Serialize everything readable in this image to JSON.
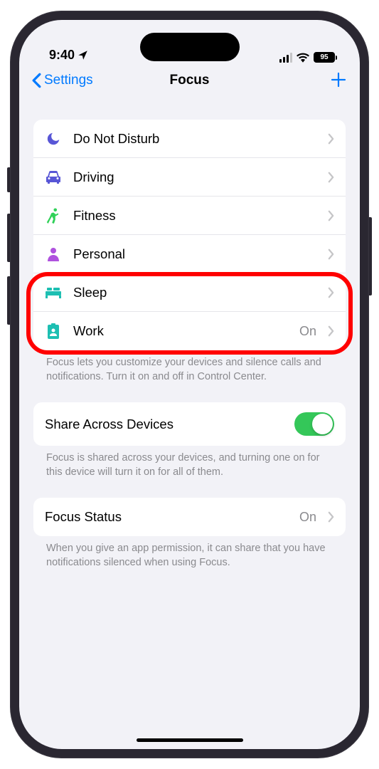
{
  "status": {
    "time": "9:40",
    "battery": "95"
  },
  "nav": {
    "back": "Settings",
    "title": "Focus"
  },
  "focus_modes": [
    {
      "label": "Do Not Disturb",
      "value": ""
    },
    {
      "label": "Driving",
      "value": ""
    },
    {
      "label": "Fitness",
      "value": ""
    },
    {
      "label": "Personal",
      "value": ""
    },
    {
      "label": "Sleep",
      "value": ""
    },
    {
      "label": "Work",
      "value": "On"
    }
  ],
  "focus_footer": "Focus lets you customize your devices and silence calls and notifications. Turn it on and off in Control Center.",
  "share": {
    "label": "Share Across Devices",
    "footer": "Focus is shared across your devices, and turning one on for this device will turn it on for all of them."
  },
  "status_row": {
    "label": "Focus Status",
    "value": "On",
    "footer": "When you give an app permission, it can share that you have notifications silenced when using Focus."
  },
  "icons": {
    "moon_color": "#5856d6",
    "car_color": "#5856d6",
    "fitness_color": "#30d158",
    "person_color": "#af52de",
    "sleep_color": "#1dbfb2",
    "work_color": "#1dbfb2"
  }
}
